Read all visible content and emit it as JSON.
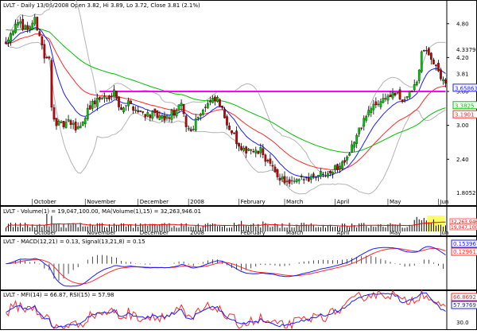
{
  "colors": {
    "up": "#00c800",
    "down": "#c80000",
    "ma_fast": "#1a1aff",
    "ma_mid": "#ff2a2a",
    "ma_slow": "#00c000",
    "bands": "#b4b4b4",
    "resistance": "#ff00ff",
    "volume_ma": "#ff0000",
    "highlight": "#ffff66",
    "price_box": "#ffffff",
    "frame": "#000000"
  },
  "chart_data": [
    {
      "type": "candlestick",
      "title": "LVLT - Daily 13/06/2008 Open 3.82, Hi 3.89, Lo 3.72, Close 3.81 (2.1%)",
      "ylim": [
        1.7,
        5.05
      ],
      "x_ticks": [
        {
          "label": "October",
          "i": 11
        },
        {
          "label": "November",
          "i": 33
        },
        {
          "label": "December",
          "i": 55
        },
        {
          "label": "2008",
          "i": 76
        },
        {
          "label": "February",
          "i": 97
        },
        {
          "label": "March",
          "i": 116
        },
        {
          "label": "April",
          "i": 137
        },
        {
          "label": "May",
          "i": 159
        },
        {
          "label": "Jun",
          "i": 180
        }
      ],
      "y_ticks": [
        4.8,
        4.2,
        3.6,
        3.0,
        2.4
      ],
      "price_labels": [
        {
          "label": "4.33797",
          "value": 4.338,
          "box": false
        },
        {
          "label": "3.81",
          "value": 3.91,
          "box": false
        },
        {
          "label": "3.65863",
          "value": 3.659,
          "box": true,
          "color": "#1a1aff"
        },
        {
          "label": "3.3825",
          "value": 3.35,
          "box": true,
          "color": "#00c000"
        },
        {
          "label": "3.1901",
          "value": 3.19,
          "box": true,
          "color": "#ff2a2a"
        },
        {
          "label": "1.80523",
          "value": 1.805,
          "box": false
        }
      ],
      "resistance": {
        "value": 3.6,
        "from_i": 39,
        "to_i": 183
      },
      "series_keys": [
        "ohlc",
        "ma_fast",
        "ma_mid",
        "ma_slow",
        "band_upper",
        "band_lower"
      ]
    },
    {
      "type": "bar",
      "title": "LVLT - Volume(1) = 19,047,100.00, MA(Volume(1),15) = 32,263,946.01",
      "highlight_range": [
        176,
        182
      ],
      "price_labels": [
        {
          "label": "32,263,946",
          "color": "#ff0000"
        },
        {
          "label": "19,047,100",
          "color": "#ff0000"
        }
      ]
    },
    {
      "type": "line",
      "title": "LVLT - MACD(12,21) = 0.13, Signal(13,21,8) = 0.15",
      "legend": [
        "MACD(12,21)",
        "Signal(13,21,8)"
      ],
      "price_labels": [
        {
          "label": "0.153967",
          "color": "#1a1aff"
        },
        {
          "label": "0.129612",
          "color": "#ff2a2a"
        }
      ]
    },
    {
      "type": "line",
      "title": "LVLT - MFI(14) = 66.87, RSI(15) = 57.98",
      "legend": [
        "MFI(14)",
        "RSI(15)"
      ],
      "y_ticks": [
        70.0,
        30.0
      ],
      "ylim": [
        20,
        82
      ],
      "price_labels": [
        {
          "label": "66.8692",
          "color": "#ff2a2a"
        },
        {
          "label": "57.9769",
          "color": "#1a1aff"
        }
      ]
    }
  ]
}
